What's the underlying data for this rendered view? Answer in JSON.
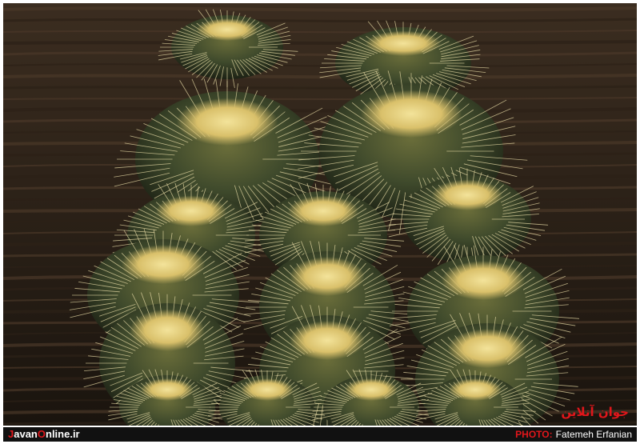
{
  "photo": {
    "subject": "golden barrel cacti",
    "colors": {
      "background": "#2a2119",
      "wood_grain": "#3a2c1f",
      "cactus_body": "#3f4a2c",
      "spines": "#e9dca6",
      "crown": "#d9c06a"
    }
  },
  "watermark": {
    "logo_text": "جوان آنلاین"
  },
  "caption": {
    "site_first_letter": "J",
    "site_middle": "avan",
    "site_accent": "O",
    "site_rest": "nline.ir",
    "credit_label": "PHOTO:",
    "credit_name": "Fatemeh Erfanian"
  }
}
